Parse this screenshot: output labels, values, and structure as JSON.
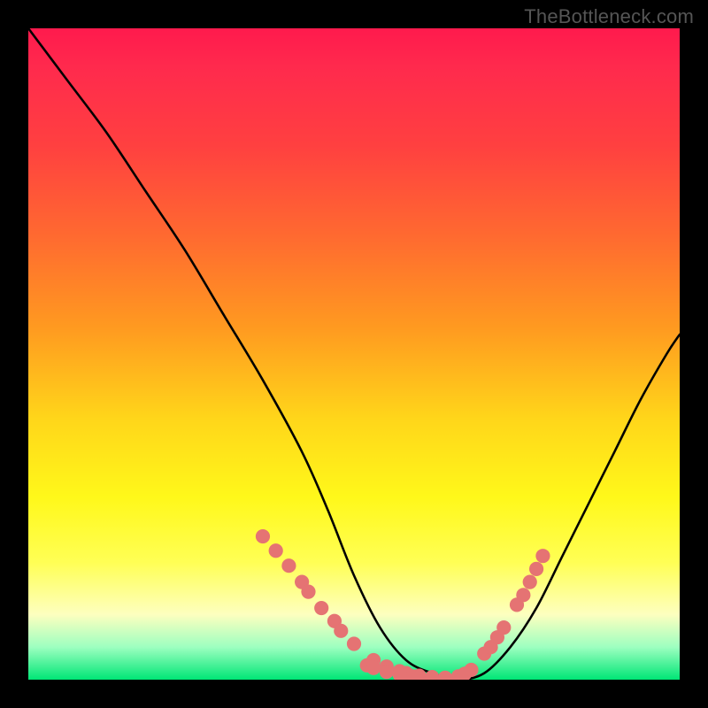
{
  "watermark": "TheBottleneck.com",
  "chart_data": {
    "type": "line",
    "title": "",
    "xlabel": "",
    "ylabel": "",
    "xlim": [
      0,
      100
    ],
    "ylim": [
      0,
      100
    ],
    "series": [
      {
        "name": "curve",
        "x": [
          0,
          6,
          12,
          18,
          24,
          30,
          36,
          42,
          46,
          50,
          54,
          58,
          62,
          66,
          70,
          74,
          78,
          82,
          86,
          90,
          94,
          98,
          100
        ],
        "values": [
          100,
          92,
          84,
          75,
          66,
          56,
          46,
          35,
          26,
          16,
          8,
          3,
          1,
          0,
          1,
          5,
          11,
          19,
          27,
          35,
          43,
          50,
          53
        ]
      }
    ],
    "marker_regions": [
      {
        "name": "left-markers",
        "x": [
          36,
          38,
          40,
          42,
          43,
          45,
          47,
          48,
          50,
          53,
          55,
          57,
          58,
          60,
          62
        ],
        "values": [
          22.0,
          19.8,
          17.5,
          15.0,
          13.5,
          11.0,
          9.0,
          7.5,
          5.5,
          3.0,
          2.0,
          1.3,
          1.0,
          0.6,
          0.4
        ]
      },
      {
        "name": "right-markers",
        "x": [
          70,
          71,
          72,
          73,
          75,
          76,
          77,
          78,
          79
        ],
        "values": [
          4.0,
          5.0,
          6.5,
          8.0,
          11.5,
          13.0,
          15.0,
          17.0,
          19.0
        ]
      },
      {
        "name": "bottom-markers",
        "x": [
          52,
          53,
          55,
          57,
          59,
          60,
          62,
          64,
          66,
          67,
          68
        ],
        "values": [
          2.2,
          1.8,
          1.2,
          0.8,
          0.5,
          0.4,
          0.3,
          0.3,
          0.5,
          0.9,
          1.5
        ]
      }
    ],
    "colors": {
      "curve": "#000000",
      "markers": "#e57373"
    }
  }
}
